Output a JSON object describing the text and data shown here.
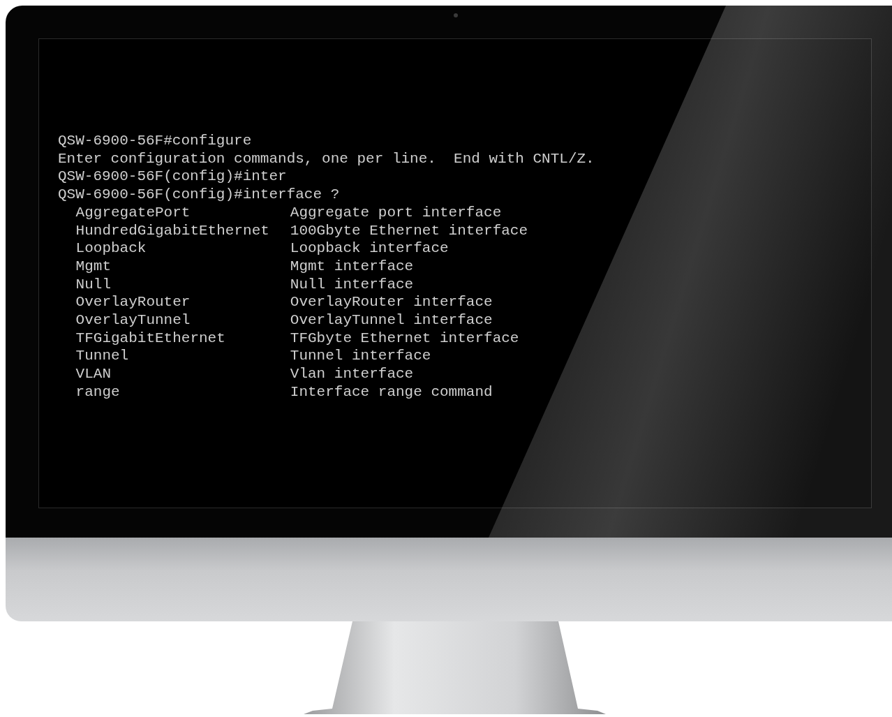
{
  "terminal": {
    "lines": [
      "QSW-6900-56F#configure",
      "Enter configuration commands, one per line.  End with CNTL/Z.",
      "QSW-6900-56F(config)#inter",
      "QSW-6900-56F(config)#interface ?"
    ],
    "options": [
      {
        "name": "AggregatePort",
        "description": "Aggregate port interface"
      },
      {
        "name": "HundredGigabitEthernet",
        "description": "100Gbyte Ethernet interface"
      },
      {
        "name": "Loopback",
        "description": "Loopback interface"
      },
      {
        "name": "Mgmt",
        "description": "Mgmt interface"
      },
      {
        "name": "Null",
        "description": "Null interface"
      },
      {
        "name": "OverlayRouter",
        "description": "OverlayRouter interface"
      },
      {
        "name": "OverlayTunnel",
        "description": "OverlayTunnel interface"
      },
      {
        "name": "TFGigabitEthernet",
        "description": "TFGbyte Ethernet interface"
      },
      {
        "name": "Tunnel",
        "description": "Tunnel interface"
      },
      {
        "name": "VLAN",
        "description": "Vlan interface"
      },
      {
        "name": "range",
        "description": "Interface range command"
      }
    ]
  }
}
